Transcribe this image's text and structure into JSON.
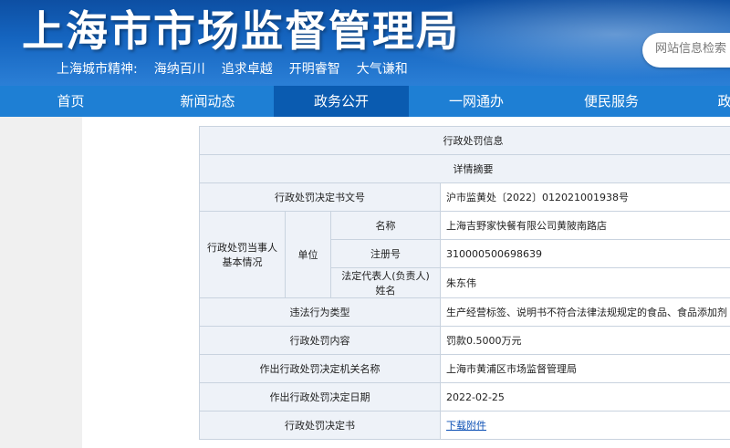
{
  "header": {
    "site_title": "上海市市场监督管理局",
    "spirit_label": "上海城市精神:",
    "spirit_items": [
      "海纳百川",
      "追求卓越",
      "开明睿智",
      "大气谦和"
    ],
    "search_placeholder": "网站信息检索"
  },
  "nav": {
    "items": [
      "首页",
      "新闻动态",
      "政务公开",
      "一网通办",
      "便民服务",
      "政"
    ],
    "active_index": 2
  },
  "detail": {
    "title": "行政处罚信息",
    "subtitle": "详情摘要",
    "rows": {
      "decision_no_label": "行政处罚决定书文号",
      "decision_no": "沪市监黄处〔2022〕012021001938号",
      "party_label": "行政处罚当事人基本情况",
      "unit_label": "单位",
      "name_label": "名称",
      "name": "上海吉野家快餐有限公司黄陂南路店",
      "reg_label": "注册号",
      "reg_no": "310000500698639",
      "rep_label": "法定代表人(负责人)姓名",
      "rep": "朱东伟",
      "violation_type_label": "违法行为类型",
      "violation_type": "生产经营标签、说明书不符合法律法规规定的食品、食品添加剂",
      "penalty_label": "行政处罚内容",
      "penalty": "罚款0.5000万元",
      "authority_label": "作出行政处罚决定机关名称",
      "authority": "上海市黄浦区市场监督管理局",
      "date_label": "作出行政处罚决定日期",
      "date": "2022-02-25",
      "doc_label": "行政处罚决定书",
      "doc_link": "下载附件"
    }
  }
}
